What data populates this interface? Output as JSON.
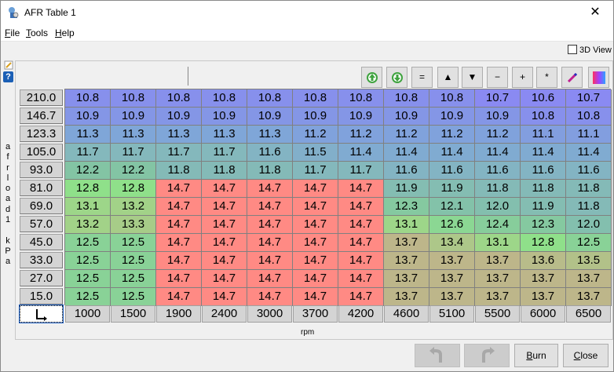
{
  "window": {
    "title": "AFR Table 1",
    "close_glyph": "✕"
  },
  "menu": [
    {
      "label": "File",
      "key": "F",
      "rest": "ile"
    },
    {
      "label": "Tools",
      "key": "T",
      "rest": "ools"
    },
    {
      "label": "Help",
      "key": "H",
      "rest": "elp"
    }
  ],
  "view3d": {
    "label": "3D View",
    "checked": false
  },
  "toolbar": {
    "buttons": [
      {
        "name": "increment-green-icon",
        "glyph": ""
      },
      {
        "name": "decrement-green-icon",
        "glyph": ""
      },
      {
        "name": "set-equal-button",
        "glyph": "="
      },
      {
        "name": "increase-button",
        "glyph": "▲"
      },
      {
        "name": "decrease-button",
        "glyph": "▼"
      },
      {
        "name": "subtract-button",
        "glyph": "−"
      },
      {
        "name": "add-button",
        "glyph": "+"
      },
      {
        "name": "multiply-button",
        "glyph": "*"
      },
      {
        "name": "interpolate-pen-icon",
        "glyph": ""
      },
      {
        "name": "color-scale-icon",
        "glyph": ""
      }
    ]
  },
  "y_axis": {
    "label_chars": [
      "a",
      "f",
      "r",
      "l",
      "o",
      "a",
      "d",
      "1",
      "",
      "k",
      "P",
      "a"
    ],
    "values": [
      "210.0",
      "146.7",
      "123.3",
      "105.0",
      "93.0",
      "81.0",
      "69.0",
      "57.0",
      "45.0",
      "33.0",
      "27.0",
      "15.0"
    ]
  },
  "x_axis": {
    "label": "rpm",
    "values": [
      "1000",
      "1500",
      "1900",
      "2400",
      "3000",
      "3700",
      "4200",
      "4600",
      "5100",
      "5500",
      "6000",
      "6500"
    ]
  },
  "table": [
    [
      "10.8",
      "10.8",
      "10.8",
      "10.8",
      "10.8",
      "10.8",
      "10.8",
      "10.8",
      "10.8",
      "10.7",
      "10.6",
      "10.7"
    ],
    [
      "10.9",
      "10.9",
      "10.9",
      "10.9",
      "10.9",
      "10.9",
      "10.9",
      "10.9",
      "10.9",
      "10.9",
      "10.8",
      "10.8"
    ],
    [
      "11.3",
      "11.3",
      "11.3",
      "11.3",
      "11.3",
      "11.2",
      "11.2",
      "11.2",
      "11.2",
      "11.2",
      "11.1",
      "11.1"
    ],
    [
      "11.7",
      "11.7",
      "11.7",
      "11.7",
      "11.6",
      "11.5",
      "11.4",
      "11.4",
      "11.4",
      "11.4",
      "11.4",
      "11.4"
    ],
    [
      "12.2",
      "12.2",
      "11.8",
      "11.8",
      "11.8",
      "11.7",
      "11.7",
      "11.6",
      "11.6",
      "11.6",
      "11.6",
      "11.6"
    ],
    [
      "12.8",
      "12.8",
      "14.7",
      "14.7",
      "14.7",
      "14.7",
      "14.7",
      "11.9",
      "11.9",
      "11.8",
      "11.8",
      "11.8"
    ],
    [
      "13.1",
      "13.2",
      "14.7",
      "14.7",
      "14.7",
      "14.7",
      "14.7",
      "12.3",
      "12.1",
      "12.0",
      "11.9",
      "11.8"
    ],
    [
      "13.2",
      "13.3",
      "14.7",
      "14.7",
      "14.7",
      "14.7",
      "14.7",
      "13.1",
      "12.6",
      "12.4",
      "12.3",
      "12.0"
    ],
    [
      "12.5",
      "12.5",
      "14.7",
      "14.7",
      "14.7",
      "14.7",
      "14.7",
      "13.7",
      "13.4",
      "13.1",
      "12.8",
      "12.5"
    ],
    [
      "12.5",
      "12.5",
      "14.7",
      "14.7",
      "14.7",
      "14.7",
      "14.7",
      "13.7",
      "13.7",
      "13.7",
      "13.6",
      "13.5"
    ],
    [
      "12.5",
      "12.5",
      "14.7",
      "14.7",
      "14.7",
      "14.7",
      "14.7",
      "13.7",
      "13.7",
      "13.7",
      "13.7",
      "13.7"
    ],
    [
      "12.5",
      "12.5",
      "14.7",
      "14.7",
      "14.7",
      "14.7",
      "14.7",
      "13.7",
      "13.7",
      "13.7",
      "13.7",
      "13.7"
    ]
  ],
  "buttons": {
    "undo": "",
    "redo": "",
    "burn": "Burn",
    "burn_key": "B",
    "burn_rest": "urn",
    "close": "Close",
    "close_key": "C",
    "close_rest": "lose"
  },
  "colors": {
    "v_10_8": "#8a8cf0",
    "v_10_9": "#8496e6",
    "v_11_3": "#7fa6d8",
    "v_11_7": "#84b8bc",
    "v_12_2": "#83c4a4",
    "v_12_8": "#8fe08a",
    "v_13_7": "#bdb68a",
    "v_14_7": "#ff8a84"
  }
}
